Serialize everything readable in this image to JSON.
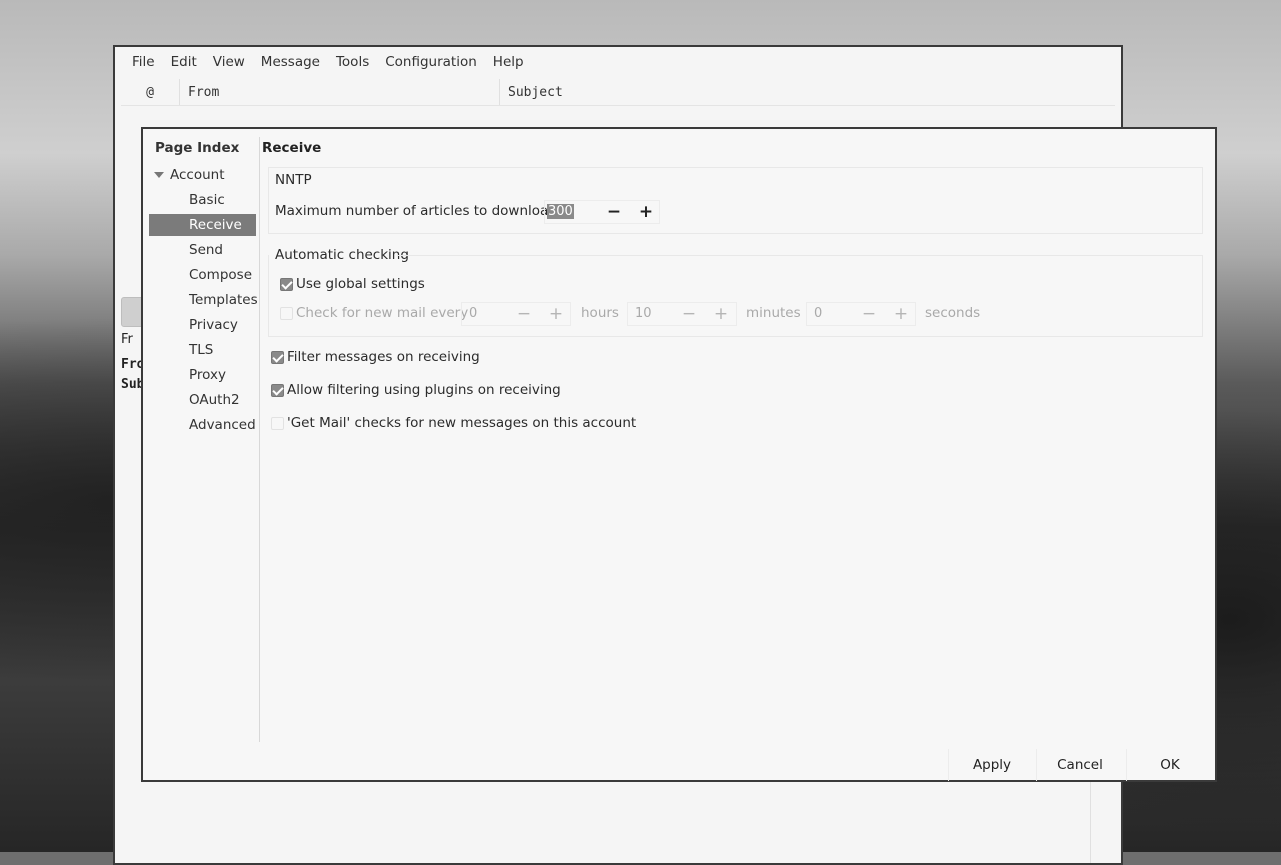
{
  "main_window": {
    "menu": [
      "File",
      "Edit",
      "View",
      "Message",
      "Tools",
      "Configuration",
      "Help"
    ],
    "columns": {
      "attach": "@",
      "from": "From",
      "subject": "Subject"
    },
    "peek_from": "Fro",
    "peek_subject": "Sub",
    "peek_tab": "Fr"
  },
  "dialog": {
    "sidebar_title": "Page Index",
    "account_label": "Account",
    "sidebar_items": [
      "Basic",
      "Receive",
      "Send",
      "Compose",
      "Templates",
      "Privacy",
      "TLS",
      "Proxy",
      "OAuth2",
      "Advanced"
    ],
    "selected_item": "Receive",
    "page_title": "Receive",
    "nntp": {
      "heading": "NNTP",
      "max_articles_label": "Maximum number of articles to download",
      "max_articles_value": "300"
    },
    "auto_check": {
      "heading": "Automatic checking",
      "use_global_label": "Use global settings",
      "use_global_checked": true,
      "check_every_label": "Check for new mail every",
      "hours_value": "0",
      "hours_unit": "hours",
      "minutes_value": "10",
      "minutes_unit": "minutes",
      "seconds_value": "0",
      "seconds_unit": "seconds"
    },
    "options": {
      "filter_on_receive": "Filter messages on receiving",
      "filter_plugins": "Allow filtering using plugins on receiving",
      "get_mail_checks": "'Get Mail' checks for new messages on this account"
    },
    "buttons": {
      "apply": "Apply",
      "cancel": "Cancel",
      "ok": "OK"
    },
    "spin_icons": {
      "minus": "−",
      "plus": "+"
    }
  }
}
